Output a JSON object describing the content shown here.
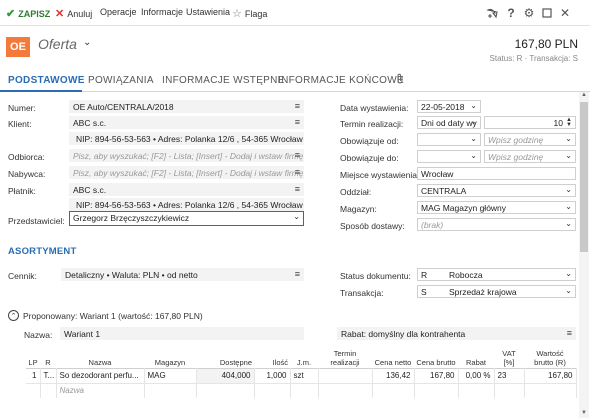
{
  "toolbar": {
    "save": "ZAPISZ",
    "cancel": "Anuluj",
    "operations": "Operacje",
    "information": "Informacje",
    "settings": "Ustawienia",
    "flag": "Flaga"
  },
  "header": {
    "badge": "OE",
    "title": "Oferta",
    "amount": "167,80 PLN",
    "status": "Status: R · Transakcja: S"
  },
  "tabs": [
    "PODSTAWOWE",
    "POWIĄZANIA",
    "INFORMACJE WSTĘPNE",
    "INFORMACJE KOŃCOWE"
  ],
  "left": {
    "number_label": "Numer:",
    "number": "OE Auto/CENTRALA/2018",
    "client_label": "Klient:",
    "client": "ABC s.c.",
    "client_info": "NIP: 894-56-53-563  •  Adres: Polanka 12/6 , 54-365 Wrocław",
    "recipient_label": "Odbiorca:",
    "recipient_placeholder": "Pisz, aby wyszukać; [F2] - Lista; [Insert] - Dodaj i wstaw firmę;",
    "buyer_label": "Nabywca:",
    "buyer_placeholder": "Pisz, aby wyszukać; [F2] - Lista; [Insert] - Dodaj i wstaw firmę;",
    "payer_label": "Płatnik:",
    "payer": "ABC s.c.",
    "payer_info": "NIP: 894-56-53-563  •  Adres: Polanka 12/6 , 54-365 Wrocław",
    "rep_label": "Przedstawiciel:",
    "rep": "Grzegorz Brzęczyszczykiewicz"
  },
  "right": {
    "issue_date_label": "Data wystawienia:",
    "issue_date": "22-05-2018",
    "term_label": "Termin realizacji:",
    "term_mode": "Dni od daty wy",
    "term_days": "10",
    "valid_from_label": "Obowiązuje od:",
    "valid_to_label": "Obowiązuje do:",
    "hour_placeholder": "Wpisz godzinę",
    "place_label": "Miejsce wystawienia:",
    "place": "Wrocław",
    "branch_label": "Oddział:",
    "branch": "CENTRALA",
    "warehouse_label": "Magazyn:",
    "warehouse": "MAG  Magazyn główny",
    "delivery_label": "Sposób dostawy:",
    "delivery": "(brak)"
  },
  "assortment": {
    "title": "ASORTYMENT",
    "pricelist_label": "Cennik:",
    "pricelist": "Detaliczny • Waluta: PLN • od netto",
    "doc_status_label": "Status dokumentu:",
    "doc_status_code": "R",
    "doc_status": "Robocza",
    "transaction_label": "Transakcja:",
    "transaction_code": "S",
    "transaction": "Sprzedaż krajowa",
    "variant_text": "Proponowany: Wariant 1 (wartość: 167,80 PLN)",
    "name_label": "Nazwa:",
    "name_value": "Wariant 1",
    "discount": "Rabat: domyślny dla kontrahenta"
  },
  "grid": {
    "headers": [
      "LP",
      "R",
      "Nazwa",
      "Magazyn",
      "Dostępne",
      "Ilość",
      "J.m.",
      "Termin realizacji",
      "Cena netto",
      "Cena brutto",
      "Rabat",
      "VAT [%]",
      "Wartość brutto (R)"
    ],
    "rows": [
      [
        "1",
        "T...",
        "So dezodorant perfu...",
        "MAG",
        "404,000",
        "1,000",
        "szt",
        "",
        "136,42",
        "167,80",
        "0,00 %",
        "23",
        "167,80"
      ]
    ],
    "new_row_placeholder": "Nazwa"
  }
}
